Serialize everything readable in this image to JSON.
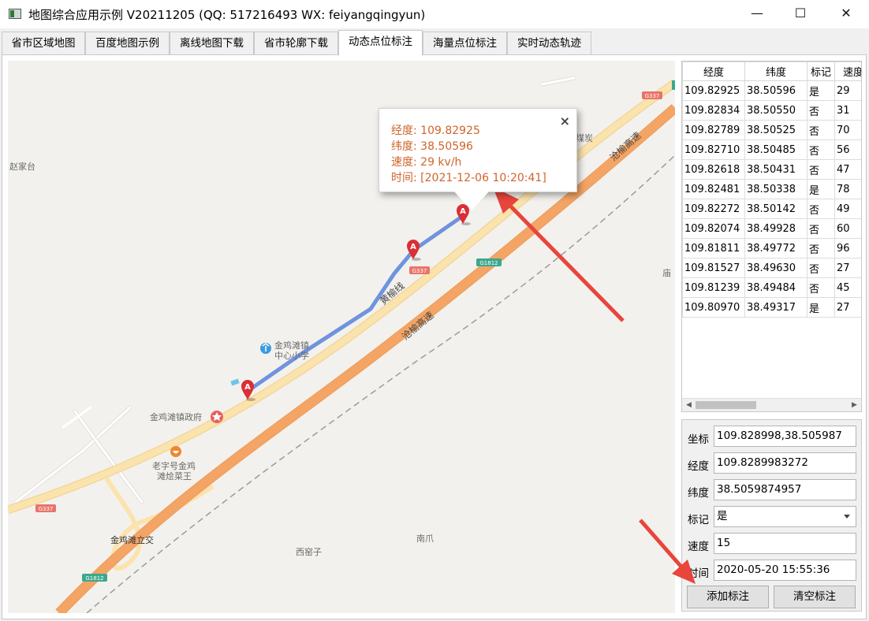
{
  "window": {
    "title": "地图综合应用示例 V20211205 (QQ: 517216493 WX: feiyangqingyun)",
    "controls": {
      "minimize": "—",
      "maximize": "☐",
      "close": "✕"
    }
  },
  "tabs": [
    {
      "label": "省市区域地图",
      "active": false
    },
    {
      "label": "百度地图示例",
      "active": false
    },
    {
      "label": "离线地图下载",
      "active": false
    },
    {
      "label": "省市轮廓下载",
      "active": false
    },
    {
      "label": "动态点位标注",
      "active": true
    },
    {
      "label": "海量点位标注",
      "active": false
    },
    {
      "label": "实时动态轨迹",
      "active": false
    }
  ],
  "map": {
    "labels": {
      "village1": "赵家台",
      "coal": "煤炭",
      "town_school_1": "金鸡滩镇",
      "town_school_2": "中心小学",
      "gov": "金鸡滩镇政府",
      "restaurant_1": "老字号金鸡",
      "restaurant_2": "滩烩菜王",
      "interchange": "金鸡滩立交",
      "xiyaozi": "西窑子",
      "nanzhua": "南爪",
      "miao": "庙",
      "road_huangyu": "黄榆线",
      "expressway_1": "沧榆高速",
      "expressway_2": "沧榆高速",
      "shield_g337_1": "G337",
      "shield_g337_2": "G337",
      "shield_g337_3": "G337",
      "shield_g1812_1": "G1812",
      "shield_g1812_2": "G1812",
      "marker_letter_1": "A",
      "marker_letter_2": "A",
      "marker_letter_3": "A"
    },
    "colors": {
      "expressway": "#f4a465",
      "national_road": "#fbe3ae",
      "track": "#6f93de",
      "marker": "#d92f35",
      "g337_shield": "#e8746a",
      "g1812_shield": "#3ba88e",
      "arrow": "#e8453c"
    },
    "popup": {
      "lng": "经度: 109.82925",
      "lat": "纬度: 38.50596",
      "speed": "速度: 29 kv/h",
      "time": "时间: [2021-12-06 10:20:41]",
      "close": "×",
      "text_color": "#d0642a"
    }
  },
  "table": {
    "headers": [
      "经度",
      "纬度",
      "标记",
      "速度"
    ],
    "rows": [
      [
        "109.82925",
        "38.50596",
        "是",
        "29"
      ],
      [
        "109.82834",
        "38.50550",
        "否",
        "31"
      ],
      [
        "109.82789",
        "38.50525",
        "否",
        "70"
      ],
      [
        "109.82710",
        "38.50485",
        "否",
        "56"
      ],
      [
        "109.82618",
        "38.50431",
        "否",
        "47"
      ],
      [
        "109.82481",
        "38.50338",
        "是",
        "78"
      ],
      [
        "109.82272",
        "38.50142",
        "否",
        "49"
      ],
      [
        "109.82074",
        "38.49928",
        "否",
        "60"
      ],
      [
        "109.81811",
        "38.49772",
        "否",
        "96"
      ],
      [
        "109.81527",
        "38.49630",
        "否",
        "27"
      ],
      [
        "109.81239",
        "38.49484",
        "否",
        "45"
      ],
      [
        "109.80970",
        "38.49317",
        "是",
        "27"
      ]
    ],
    "scroll_left": "◀",
    "scroll_right": "▶"
  },
  "form": {
    "coord_label": "坐标",
    "coord_value": "109.828998,38.505987",
    "lng_label": "经度",
    "lng_value": "109.8289983272",
    "lat_label": "纬度",
    "lat_value": "38.5059874957",
    "mark_label": "标记",
    "mark_value": "是",
    "speed_label": "速度",
    "speed_value": "15",
    "time_label": "时间",
    "time_value": "2020-05-20 15:55:36",
    "add_button": "添加标注",
    "clear_button": "清空标注"
  }
}
